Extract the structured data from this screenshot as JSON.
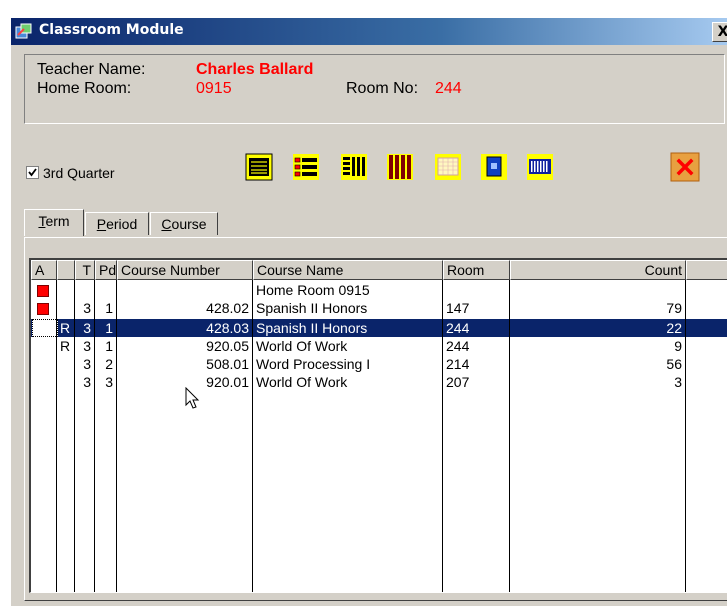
{
  "window": {
    "title": "Classroom Module",
    "close_label": "X"
  },
  "teacher": {
    "name_label": "Teacher Name:",
    "name_value": "Charles Ballard",
    "homeroom_label": "Home Room:",
    "homeroom_value": "0915",
    "roomno_label": "Room No:",
    "roomno_value": "244"
  },
  "quarter": {
    "label": "3rd Quarter",
    "checked": true
  },
  "toolbar": {
    "icons": [
      "report-icon",
      "list-icon",
      "columns-icon",
      "barcode-red-icon",
      "calendar-icon",
      "id-card-icon",
      "barcode-icon"
    ],
    "close_icon": "close-red-icon",
    "close_color": "#ff0000"
  },
  "tabs": [
    {
      "label": "Term",
      "mnemonic": "T",
      "rest": "erm",
      "active": true
    },
    {
      "label": "Period",
      "mnemonic": "P",
      "rest": "eriod",
      "active": false
    },
    {
      "label": "Course",
      "mnemonic": "C",
      "rest": "ourse",
      "active": false
    }
  ],
  "grid": {
    "columns": [
      "A",
      "",
      "T",
      "Pd",
      "Course Number",
      "Course Name",
      "Room",
      "Count"
    ],
    "rows": [
      {
        "a": true,
        "r": "",
        "t": "",
        "pd": "",
        "num": "",
        "name": "Home Room 0915",
        "room": "",
        "count": ""
      },
      {
        "a": true,
        "r": "",
        "t": "3",
        "pd": "1",
        "num": "428.02",
        "name": "Spanish II Honors",
        "room": "147",
        "count": "79"
      },
      {
        "a": false,
        "r": "R",
        "t": "3",
        "pd": "1",
        "num": "428.03",
        "name": "Spanish II Honors",
        "room": "244",
        "count": "22",
        "selected": true
      },
      {
        "a": false,
        "r": "R",
        "t": "3",
        "pd": "1",
        "num": "920.05",
        "name": "World Of Work",
        "room": "244",
        "count": "9"
      },
      {
        "a": false,
        "r": "",
        "t": "3",
        "pd": "2",
        "num": "508.01",
        "name": "Word Processing I",
        "room": "214",
        "count": "56"
      },
      {
        "a": false,
        "r": "",
        "t": "3",
        "pd": "3",
        "num": "920.01",
        "name": "World Of Work",
        "room": "207",
        "count": "3"
      }
    ],
    "flag_color": "#ff0000",
    "selection_color": "#0a246a"
  }
}
